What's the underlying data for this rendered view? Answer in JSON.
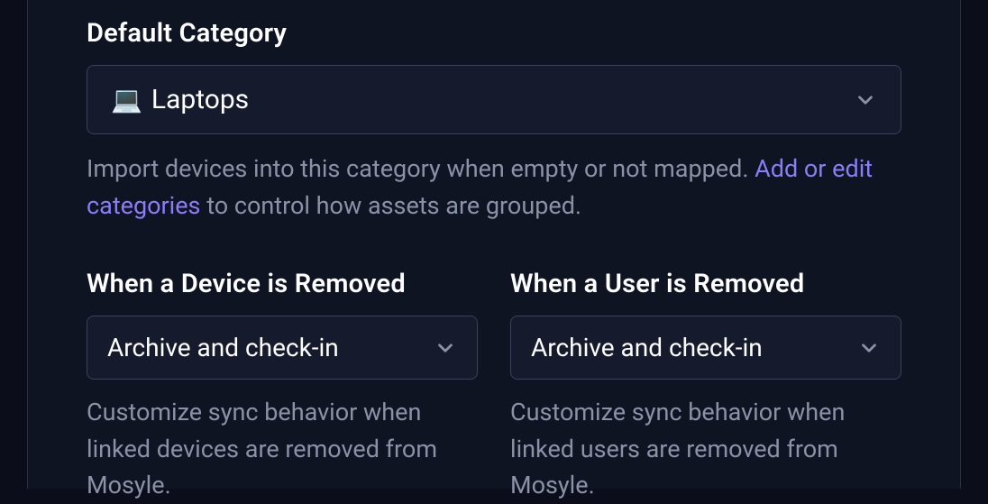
{
  "default_category": {
    "label": "Default Category",
    "value": "Laptops",
    "icon_name": "laptop-emoji",
    "helper_pre": "Import devices into this category when empty or not mapped. ",
    "helper_link": "Add or edit categories",
    "helper_post": " to control how assets are grouped."
  },
  "device_removed": {
    "label": "When a Device is Removed",
    "value": "Archive and check-in",
    "helper": "Customize sync behavior when linked devices are removed from Mosyle."
  },
  "user_removed": {
    "label": "When a User is Removed",
    "value": "Archive and check-in",
    "helper": "Customize sync behavior when linked users are removed from Mosyle."
  }
}
